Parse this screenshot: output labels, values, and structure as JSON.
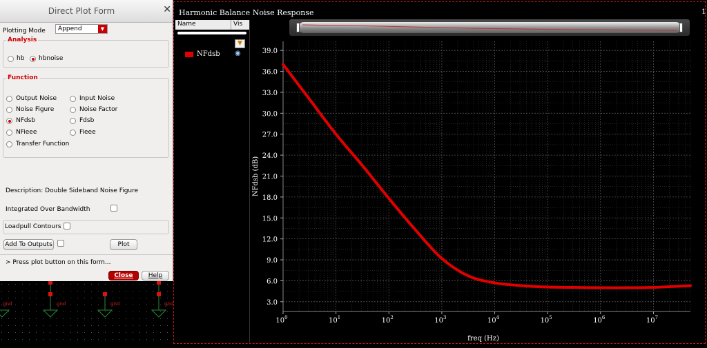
{
  "form": {
    "title": "Direct Plot Form",
    "plotting_mode_label": "Plotting Mode",
    "plotting_mode_value": "Append",
    "analysis": {
      "title": "Analysis",
      "options": [
        {
          "label": "hb",
          "selected": false
        },
        {
          "label": "hbnoise",
          "selected": true
        }
      ]
    },
    "function": {
      "title": "Function",
      "options": [
        {
          "label": "Output Noise",
          "selected": false
        },
        {
          "label": "Input Noise",
          "selected": false
        },
        {
          "label": "Noise Figure",
          "selected": false
        },
        {
          "label": "Noise Factor",
          "selected": false
        },
        {
          "label": "NFdsb",
          "selected": true
        },
        {
          "label": "Fdsb",
          "selected": false
        },
        {
          "label": "NFieee",
          "selected": false
        },
        {
          "label": "Fieee",
          "selected": false
        },
        {
          "label": "Transfer Function",
          "selected": false
        }
      ]
    },
    "description": "Description: Double Sideband Noise Figure",
    "integrated_label": "Integrated Over Bandwidth",
    "loadpull_label": "Loadpull Contours",
    "add_to_outputs_label": "Add To Outputs",
    "plot_label": "Plot",
    "status": "> Press plot button on this form...",
    "close_label": "Close",
    "help_label": "Help"
  },
  "schematic": {
    "labels": [
      "gnd",
      "gnd",
      "gnd",
      "gnd"
    ]
  },
  "plot": {
    "window_title": "Harmonic Balance Noise Response",
    "corner_label": "1",
    "legend": {
      "name_header": "Name",
      "vis_header": "Vis",
      "items": [
        {
          "name": "NFdsb",
          "color": "#e00000",
          "icon": "eye-icon"
        }
      ]
    },
    "filter_icon": "filter-icon"
  },
  "colors": {
    "accent": "#cc0000",
    "trace": "#e00000",
    "plot_bg": "#000000",
    "axis_text": "#ffffff"
  },
  "chart_data": {
    "type": "line",
    "title": "",
    "xlabel": "freq (Hz)",
    "ylabel": "NFdsb (dB)",
    "x_scale": "log",
    "xlim": [
      1,
      50000000
    ],
    "ylim": [
      1.6,
      40.3
    ],
    "grid": true,
    "legend_placement": "left-panel",
    "x_ticks": [
      {
        "base": "10",
        "exp": "0"
      },
      {
        "base": "10",
        "exp": "1"
      },
      {
        "base": "10",
        "exp": "2"
      },
      {
        "base": "10",
        "exp": "3"
      },
      {
        "base": "10",
        "exp": "4"
      },
      {
        "base": "10",
        "exp": "5"
      },
      {
        "base": "10",
        "exp": "6"
      },
      {
        "base": "10",
        "exp": "7"
      }
    ],
    "y_ticks": [
      "3.0",
      "6.0",
      "9.0",
      "12.0",
      "15.0",
      "18.0",
      "21.0",
      "24.0",
      "27.0",
      "30.0",
      "33.0",
      "36.0",
      "39.0"
    ],
    "series": [
      {
        "name": "NFdsb",
        "color": "#e00000",
        "x": [
          1,
          3.16,
          10,
          31.6,
          100,
          316,
          1000,
          3160,
          10000,
          31600,
          100000,
          316000,
          1000000,
          3160000,
          10000000,
          50000000
        ],
        "y": [
          37.0,
          32.0,
          27.0,
          22.5,
          17.8,
          13.3,
          9.2,
          6.7,
          5.7,
          5.3,
          5.1,
          5.05,
          5.0,
          5.0,
          5.05,
          5.3
        ]
      }
    ]
  }
}
